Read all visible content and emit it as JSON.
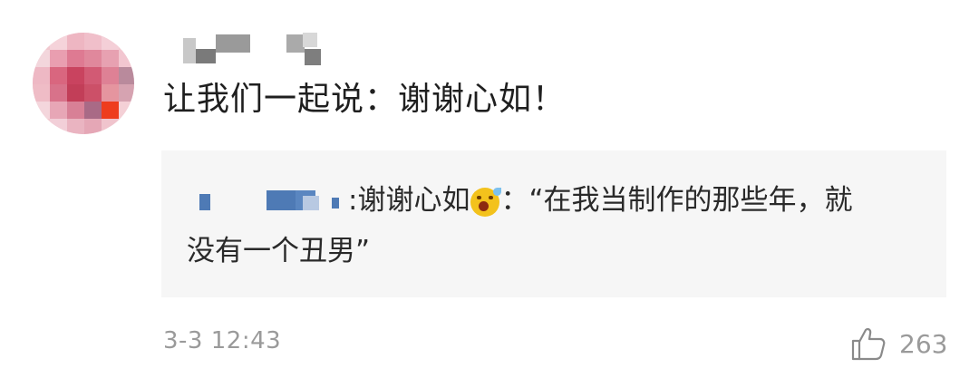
{
  "comment": {
    "author_avatar": "pixelated-avatar",
    "author_name": "",
    "text": "让我们一起说：谢谢心如！",
    "quote": {
      "user": "",
      "line1_text": ":谢谢心如",
      "emoji": "sweat-laugh-emoji",
      "line1_rest": "：“在我当制作的那些年，就",
      "line2": "没有一个丑男”"
    },
    "timestamp": "3-3 12:43",
    "like": {
      "icon": "thumbs-up-icon",
      "count": "263"
    }
  },
  "colors": {
    "timestamp": "#9a9a9a",
    "quote_background": "#f6f6f6",
    "redacted_blue": "#4e7ab5"
  }
}
